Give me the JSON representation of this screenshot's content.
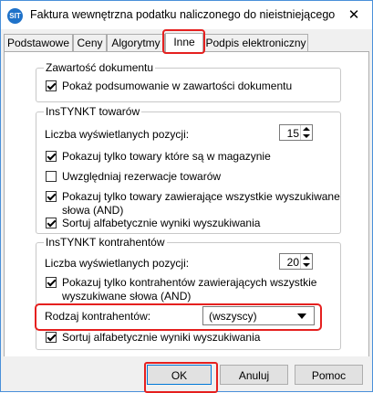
{
  "window": {
    "title": "Faktura wewnętrzna podatku naliczonego do nieistniejącego",
    "icon": "app-logo-icon",
    "icon_text": "SIT",
    "close_label": "✕"
  },
  "tabs": [
    {
      "label": "Podstawowe",
      "active": false
    },
    {
      "label": "Ceny",
      "active": false
    },
    {
      "label": "Algorytmy",
      "active": false
    },
    {
      "label": "Inne",
      "active": true
    },
    {
      "label": "Podpis elektroniczny",
      "active": false
    }
  ],
  "groups": {
    "document": {
      "title": "Zawartość dokumentu",
      "show_summary": {
        "label": "Pokaż podsumowanie w zawartości dokumentu",
        "checked": true
      }
    },
    "goods": {
      "title": "InsTYNKT towarów",
      "count_label": "Liczba wyświetlanych pozycji:",
      "count_value": "15",
      "only_in_stock": {
        "label": "Pokazuj tylko towary które są w magazynie",
        "checked": true
      },
      "consider_reservations": {
        "label": "Uwzględniaj rezerwacje towarów",
        "checked": false
      },
      "all_words": {
        "label_line1": "Pokazuj tylko towary zawierające wszystkie wyszukiwane",
        "label_line2": "słowa (AND)",
        "checked": true
      },
      "sort_alpha": {
        "label": "Sortuj alfabetycznie wyniki wyszukiwania",
        "checked": true
      }
    },
    "contractors": {
      "title": "InsTYNKT kontrahentów",
      "count_label": "Liczba wyświetlanych pozycji:",
      "count_value": "20",
      "all_words": {
        "label_line1": "Pokazuj tylko kontrahentów zawierających wszystkie",
        "label_line2": "wyszukiwane słowa (AND)",
        "checked": true
      },
      "type_label": "Rodzaj kontrahentów:",
      "type_value": "(wszyscy)",
      "sort_alpha": {
        "label": "Sortuj alfabetycznie wyniki wyszukiwania",
        "checked": true
      }
    }
  },
  "buttons": {
    "ok": "OK",
    "cancel": "Anuluj",
    "help": "Pomoc"
  },
  "colors": {
    "highlight": "#e5201f",
    "window_border": "#4a90d9"
  }
}
